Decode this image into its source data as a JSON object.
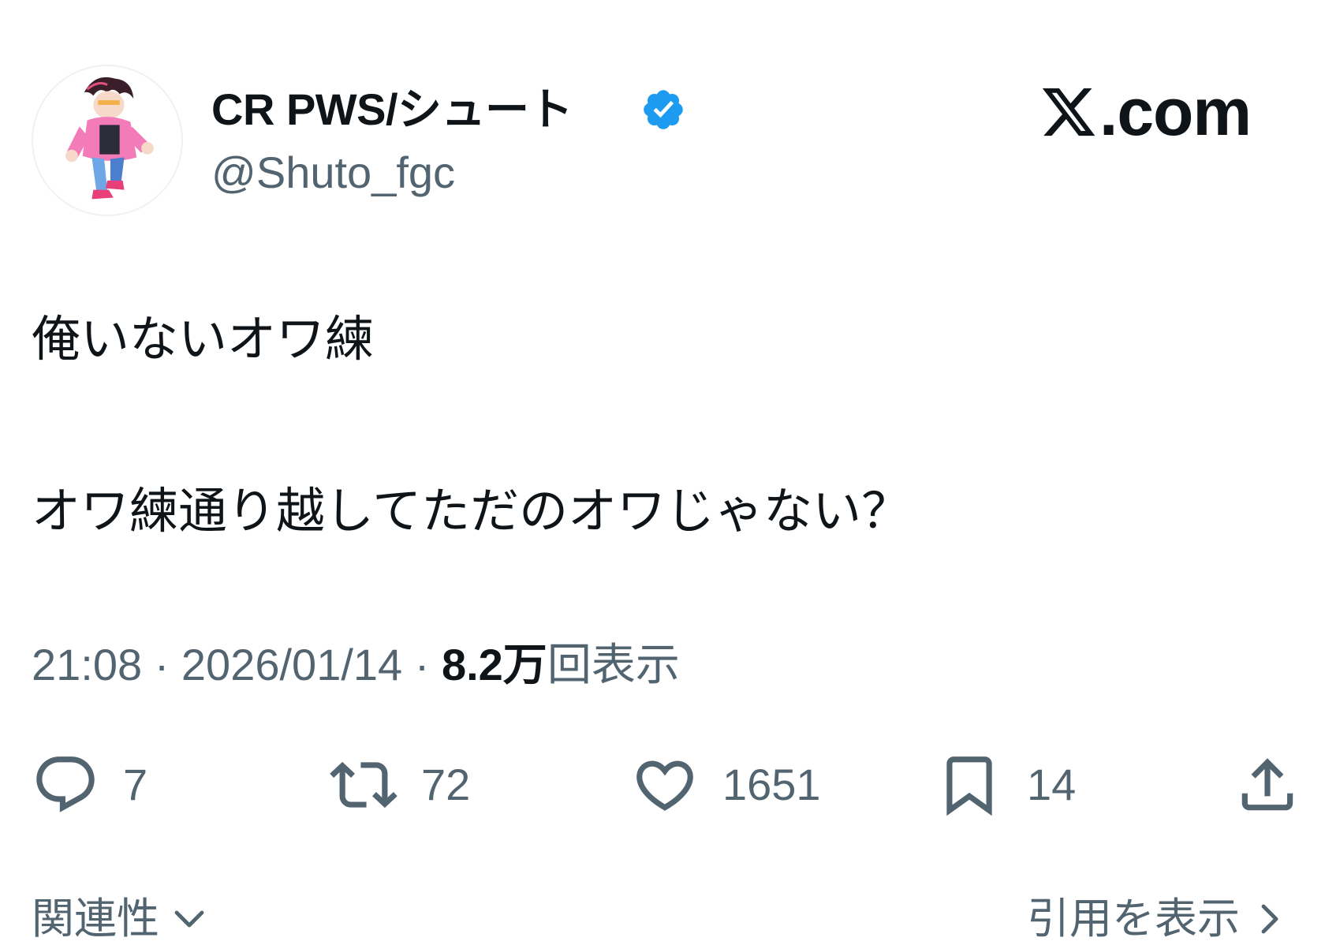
{
  "author": {
    "display_name": "CR PWS/シュート",
    "handle": "@Shuto_fgc",
    "verified": true,
    "verified_color": "#1d9bf0"
  },
  "brand": {
    "text": ".com",
    "icon": "x-logo-icon"
  },
  "tweet": {
    "lines": [
      "俺いないオワ練",
      "オワ練通り越してただのオワじゃない？"
    ]
  },
  "meta": {
    "time": "21:08",
    "separator1": " · ",
    "date": "2026/01/14",
    "separator2": " · ",
    "views_count": "8.2万",
    "views_label": "回表示"
  },
  "actions": {
    "replies": {
      "icon": "reply-icon",
      "count": "7"
    },
    "retweets": {
      "icon": "retweet-icon",
      "count": "72"
    },
    "likes": {
      "icon": "heart-icon",
      "count": "1651"
    },
    "bookmarks": {
      "icon": "bookmark-icon",
      "count": "14"
    },
    "share": {
      "icon": "share-icon"
    }
  },
  "footer": {
    "sort_label": "関連性",
    "quotes_label": "引用を表示"
  },
  "colors": {
    "text_primary": "#0f1419",
    "text_secondary": "#536471",
    "accent": "#1d9bf0"
  }
}
